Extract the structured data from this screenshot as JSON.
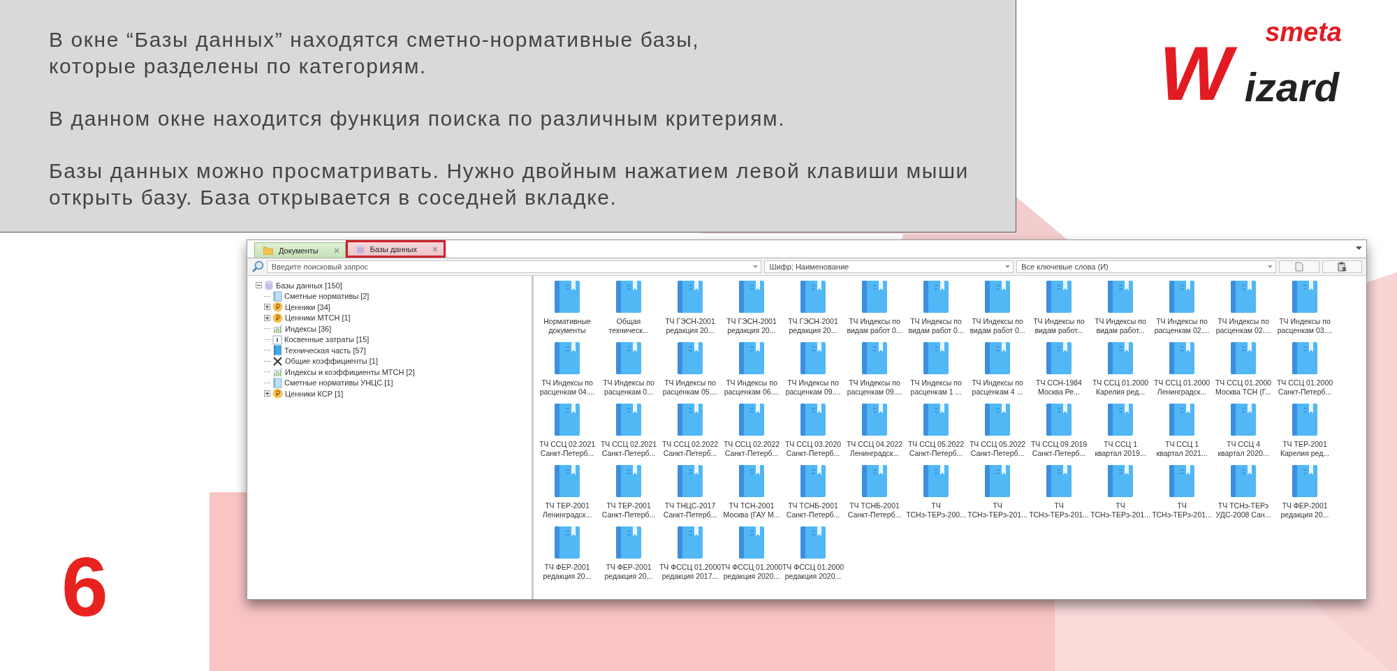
{
  "slide": {
    "paragraphs": [
      [
        "В окне “Базы данных” находятся сметно-нормативные базы,",
        "которые разделены по категориям."
      ],
      [
        "В данном окне находится функция поиска по различным критериям."
      ],
      [
        "Базы данных можно просматривать. Нужно двойным нажатием левой клавиши мыши",
        "открыть базу. База открывается в соседней вкладке."
      ]
    ],
    "logo": {
      "small": "smeta",
      "initial": "W",
      "rest": "izard"
    },
    "step_number": "6"
  },
  "tabs": [
    {
      "label": "Документы",
      "kind": "folder",
      "selected": false
    },
    {
      "label": "Базы данных",
      "kind": "database",
      "selected": true
    }
  ],
  "search": {
    "placeholder": "Введите поисковый запрос",
    "field": "Шифр; Наименование",
    "mode": "Все ключевые слова (И)"
  },
  "tree": {
    "label": "Базы данных [150]",
    "kind": "database",
    "expanded": true,
    "children": [
      {
        "label": "Сметные нормативы [2]",
        "kind": "book"
      },
      {
        "label": "Ценники [34]",
        "kind": "coin",
        "expanded": false
      },
      {
        "label": "Ценники МТСН [1]",
        "kind": "coin",
        "expanded": false
      },
      {
        "label": "Индексы [36]",
        "kind": "chart"
      },
      {
        "label": "Косвенные затраты [15]",
        "kind": "info"
      },
      {
        "label": "Техническая часть [57]",
        "kind": "techbook"
      },
      {
        "label": "Общие коэффициенты [1]",
        "kind": "tools"
      },
      {
        "label": "Индексы и коэффициенты МТСН [2]",
        "kind": "chart"
      },
      {
        "label": "Сметные нормативы УНЦС [1]",
        "kind": "book"
      },
      {
        "label": "Ценники КСР [1]",
        "kind": "coin",
        "expanded": false
      }
    ]
  },
  "items": [
    [
      "Нормативные",
      "документы"
    ],
    [
      "Общая",
      "техническ..."
    ],
    [
      "ТЧ ГЭСН-2001",
      "редакция 20..."
    ],
    [
      "ТЧ ГЭСН-2001",
      "редакция 20..."
    ],
    [
      "ТЧ ГЭСН-2001",
      "редакция 20..."
    ],
    [
      "ТЧ Индексы по",
      "видам работ 0..."
    ],
    [
      "ТЧ Индексы по",
      "видам работ 0..."
    ],
    [
      "ТЧ Индексы по",
      "видам работ 0..."
    ],
    [
      "ТЧ Индексы по",
      "видам работ..."
    ],
    [
      "ТЧ Индексы по",
      "видам работ..."
    ],
    [
      "ТЧ Индексы по",
      "расценкам 02...."
    ],
    [
      "ТЧ Индексы по",
      "расценкам 02...."
    ],
    [
      "ТЧ Индексы по",
      "расценкам 03...."
    ],
    [
      "ТЧ Индексы по",
      "расценкам 04...."
    ],
    [
      "ТЧ Индексы по",
      "расценкам 0..."
    ],
    [
      "ТЧ Индексы по",
      "расценкам 05...."
    ],
    [
      "ТЧ Индексы по",
      "расценкам 06...."
    ],
    [
      "ТЧ Индексы по",
      "расценкам 09...."
    ],
    [
      "ТЧ Индексы по",
      "расценкам 09...."
    ],
    [
      "ТЧ Индексы по",
      "расценкам 1 ..."
    ],
    [
      "ТЧ Индексы по",
      "расценкам 4 ..."
    ],
    [
      "ТЧ ССН-1984",
      "Москва Ре..."
    ],
    [
      "ТЧ ССЦ 01.2000",
      "Карелия ред..."
    ],
    [
      "ТЧ ССЦ 01.2000",
      "Ленинградск..."
    ],
    [
      "ТЧ ССЦ 01.2000",
      "Москва ТСН (Г..."
    ],
    [
      "ТЧ ССЦ 01.2000",
      "Санкт-Петерб..."
    ],
    [
      "ТЧ ССЦ 02.2021",
      "Санкт-Петерб..."
    ],
    [
      "ТЧ ССЦ 02.2021",
      "Санкт-Петерб..."
    ],
    [
      "ТЧ ССЦ 02.2022",
      "Санкт-Петерб..."
    ],
    [
      "ТЧ ССЦ 02.2022",
      "Санкт-Петерб..."
    ],
    [
      "ТЧ ССЦ 03.2020",
      "Санкт-Петерб..."
    ],
    [
      "ТЧ ССЦ 04.2022",
      "Ленинградск..."
    ],
    [
      "ТЧ ССЦ 05.2022",
      "Санкт-Петерб..."
    ],
    [
      "ТЧ ССЦ 05.2022",
      "Санкт-Петерб..."
    ],
    [
      "ТЧ ССЦ 09.2019",
      "Санкт-Петерб..."
    ],
    [
      "ТЧ ССЦ 1",
      "квартал 2019..."
    ],
    [
      "ТЧ ССЦ 1",
      "квартал 2021..."
    ],
    [
      "ТЧ ССЦ 4",
      "квартал 2020..."
    ],
    [
      "ТЧ ТЕР-2001",
      "Карелия ред..."
    ],
    [
      "ТЧ ТЕР-2001",
      "Ленинградск..."
    ],
    [
      "ТЧ ТЕР-2001",
      "Санкт-Петерб..."
    ],
    [
      "ТЧ ТНЦС-2017",
      "Санкт-Петерб..."
    ],
    [
      "ТЧ ТСН-2001",
      "Москва (ГАУ М..."
    ],
    [
      "ТЧ ТСНБ-2001",
      "Санкт-Петерб..."
    ],
    [
      "ТЧ ТСНБ-2001",
      "Санкт-Петерб..."
    ],
    [
      "ТЧ",
      "ТСНэ-ТЕРэ-200..."
    ],
    [
      "ТЧ",
      "ТСНэ-ТЕРэ-201..."
    ],
    [
      "ТЧ",
      "ТСНэ-ТЕРэ-201..."
    ],
    [
      "ТЧ",
      "ТСНэ-ТЕРэ-201..."
    ],
    [
      "ТЧ",
      "ТСНэ-ТЕРэ-201..."
    ],
    [
      "ТЧ ТСНэ-ТЕРэ",
      "УДС-2008 Сан..."
    ],
    [
      "ТЧ ФЕР-2001",
      "редакция 20..."
    ],
    [
      "ТЧ ФЕР-2001",
      "редакция 20..."
    ],
    [
      "ТЧ ФЕР-2001",
      "редакция 20..."
    ],
    [
      "ТЧ ФССЦ 01.2000",
      "редакция 2017..."
    ],
    [
      "ТЧ ФССЦ 01.2000",
      "редакция 2020..."
    ],
    [
      "ТЧ ФССЦ 01.2000",
      "редакция 2020..."
    ]
  ]
}
